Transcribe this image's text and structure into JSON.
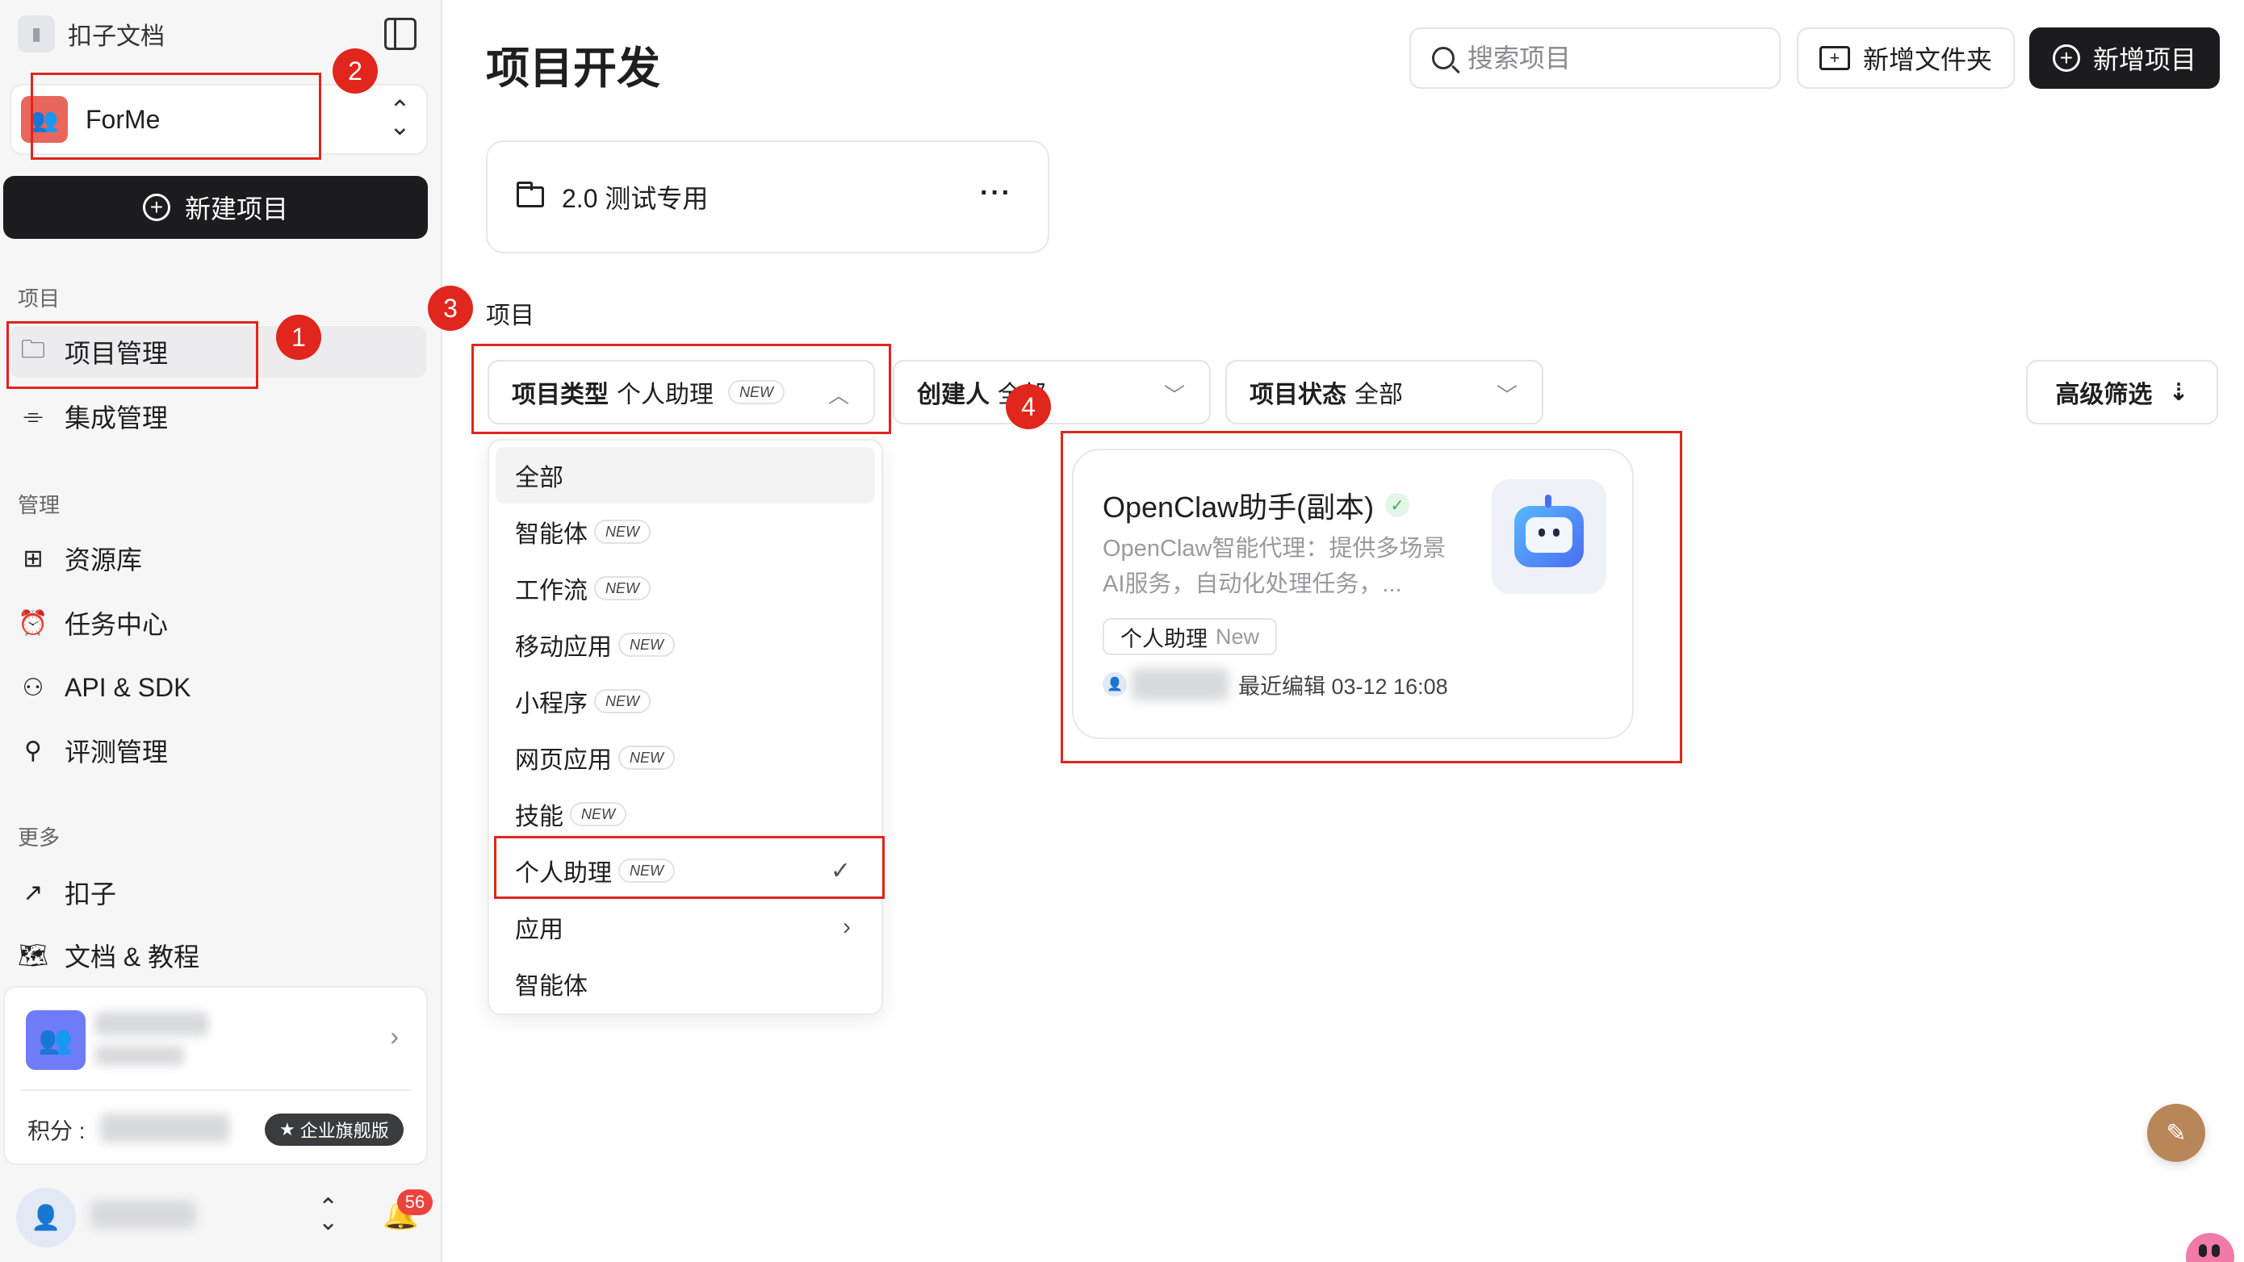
{
  "sidebar": {
    "brand": "扣子文档",
    "workspace": "ForMe",
    "new_project": "新建项目",
    "section_project": "项目",
    "section_manage": "管理",
    "section_more": "更多",
    "items": {
      "project_mgmt": "项目管理",
      "integration": "集成管理",
      "resources": "资源库",
      "tasks": "任务中心",
      "api": "API & SDK",
      "evaluation": "评测管理",
      "coze": "扣子",
      "docs": "文档 & 教程"
    },
    "points_label": "积分 :",
    "plan_badge": "企业旗舰版",
    "notification_count": "56"
  },
  "main": {
    "title": "项目开发",
    "search_placeholder": "搜索项目",
    "new_folder": "新增文件夹",
    "new_project": "新增项目",
    "folder_name": "2.0 测试专用",
    "section_title": "项目",
    "filters": {
      "type_label": "项目类型",
      "type_value": "个人助理",
      "type_tag": "NEW",
      "creator_label": "创建人",
      "creator_value": "全部",
      "status_label": "项目状态",
      "status_value": "全部",
      "advanced": "高级筛选"
    },
    "dropdown": {
      "options": [
        "全部",
        "智能体",
        "工作流",
        "移动应用",
        "小程序",
        "网页应用",
        "技能",
        "个人助理",
        "应用",
        "智能体"
      ],
      "new_tag": "NEW",
      "selected": "个人助理"
    },
    "project_card": {
      "title": "OpenClaw助手(副本)",
      "description": "OpenClaw智能代理：提供多场景AI服务，自动化处理任务，...",
      "tag": "个人助理",
      "tag_new": "New",
      "meta": "最近编辑 03-12 16:08"
    }
  },
  "annotations": [
    "1",
    "2",
    "3",
    "4"
  ],
  "colors": {
    "annotation": "#e0261d",
    "primary_dark": "#1c1c1e",
    "workspace": "#e8665b"
  }
}
